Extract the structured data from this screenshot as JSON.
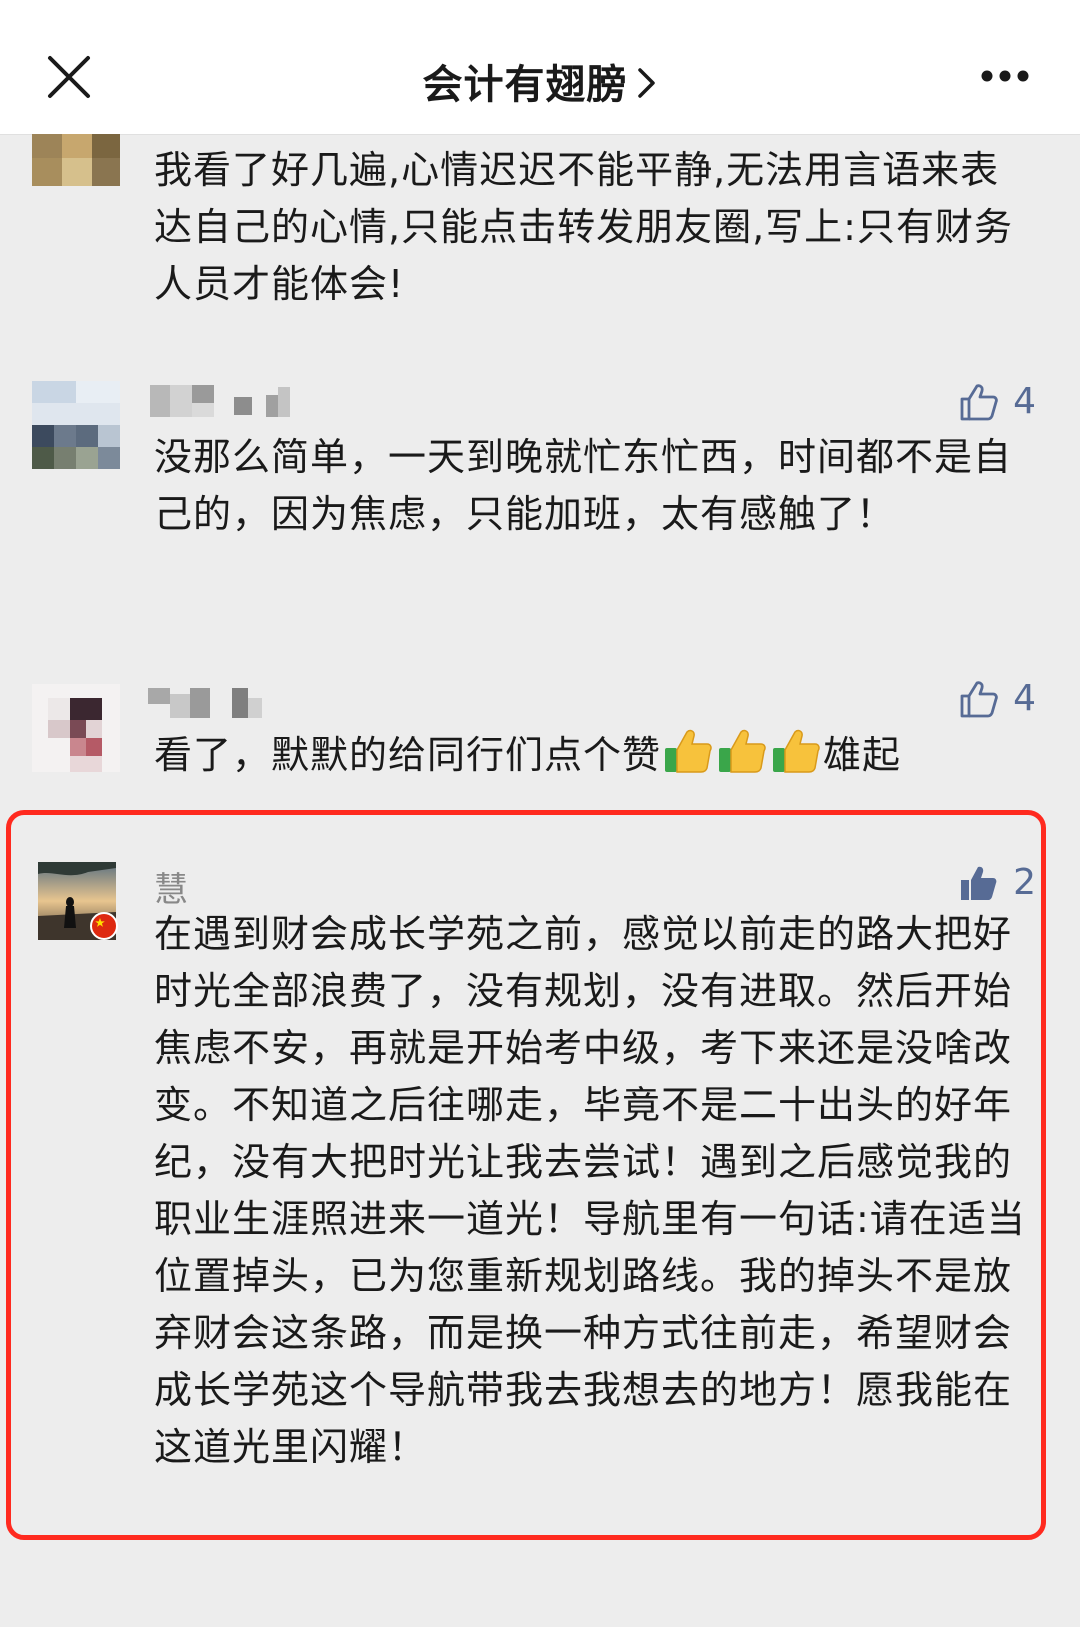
{
  "header": {
    "title": "会计有翅膀",
    "close_icon": "close-icon",
    "more_icon": "more-icon",
    "chevron_icon": "chevron-right-icon"
  },
  "colors": {
    "like_blue": "#576b95",
    "highlight_red": "#ff2a1f",
    "background": "#ededed"
  },
  "comments": [
    {
      "text": "我看了好几遍,心情迟迟不能平静,无法用言语来表达自己的心情,只能点击转发朋友圈,写上:只有财务人员才能体会!"
    },
    {
      "name": "",
      "likes": "4",
      "text": "没那么简单，一天到晚就忙东忙西，时间都不是自己的，因为焦虑，只能加班，太有感触了！"
    },
    {
      "name": "",
      "likes": "4",
      "text_before": "看了，默默的给同行们点个赞",
      "text_after": "雄起",
      "emoji": "thumbs-up-emoji"
    },
    {
      "name": "慧",
      "likes": "2",
      "text": "在遇到财会成长学苑之前，感觉以前走的路大把好时光全部浪费了，没有规划，没有进取。然后开始焦虑不安，再就是开始考中级，考下来还是没啥改变。不知道之后往哪走，毕竟不是二十出头的好年纪，没有大把时光让我去尝试！遇到之后感觉我的职业生涯照进来一道光！导航里有一句话:请在适当位置掉头，已为您重新规划路线。我的掉头不是放弃财会这条路，而是换一种方式往前走，希望财会成长学苑这个导航带我去我想去的地方！愿我能在这道光里闪耀！"
    }
  ]
}
